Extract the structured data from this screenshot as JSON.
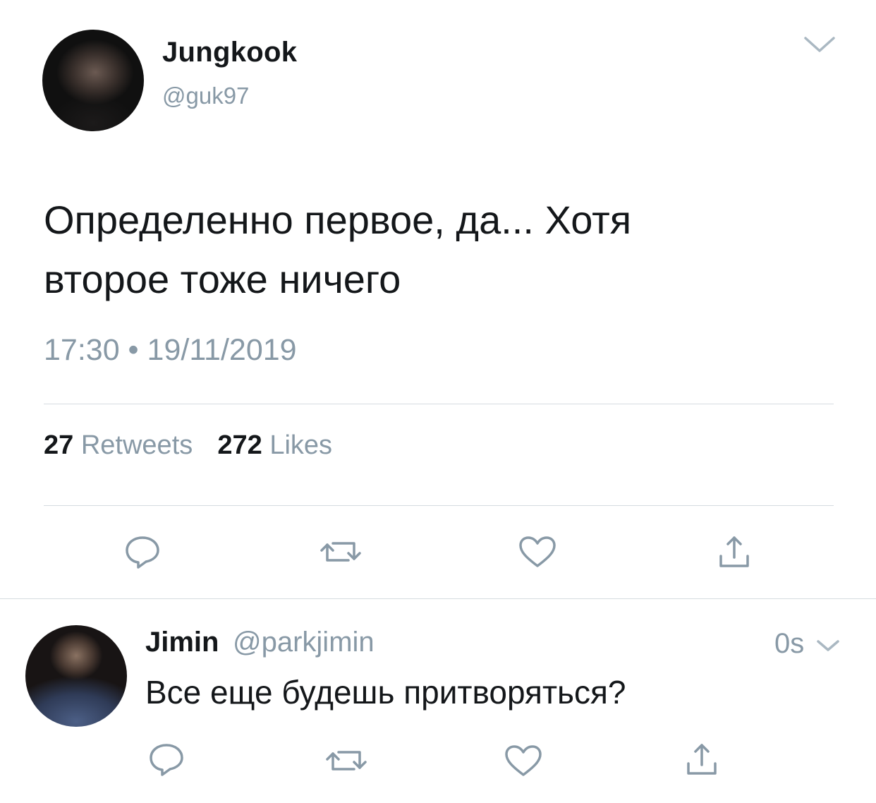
{
  "tweet": {
    "author_name": "Jungkook",
    "author_handle": "@guk97",
    "text": "Определенно первое, да... Хотя\nвторое тоже ничего",
    "timestamp": "17:30 • 19/11/2019",
    "retweets_count": "27",
    "retweets_label": "Retweets",
    "likes_count": "272",
    "likes_label": "Likes",
    "menu_icon": "chevron-down-icon",
    "actions": [
      "reply-icon",
      "retweet-icon",
      "like-icon",
      "share-icon"
    ]
  },
  "reply": {
    "author_name": "Jimin",
    "author_handle": "@parkjimin",
    "time": "0s",
    "text": "Все еще будешь притворяться?",
    "menu_icon": "chevron-down-icon",
    "actions": [
      "reply-icon",
      "retweet-icon",
      "like-icon",
      "share-icon"
    ]
  },
  "colors": {
    "text": "#14171a",
    "secondary": "#8899a6",
    "divider": "#d5dbe0",
    "icon": "#8899a6"
  }
}
